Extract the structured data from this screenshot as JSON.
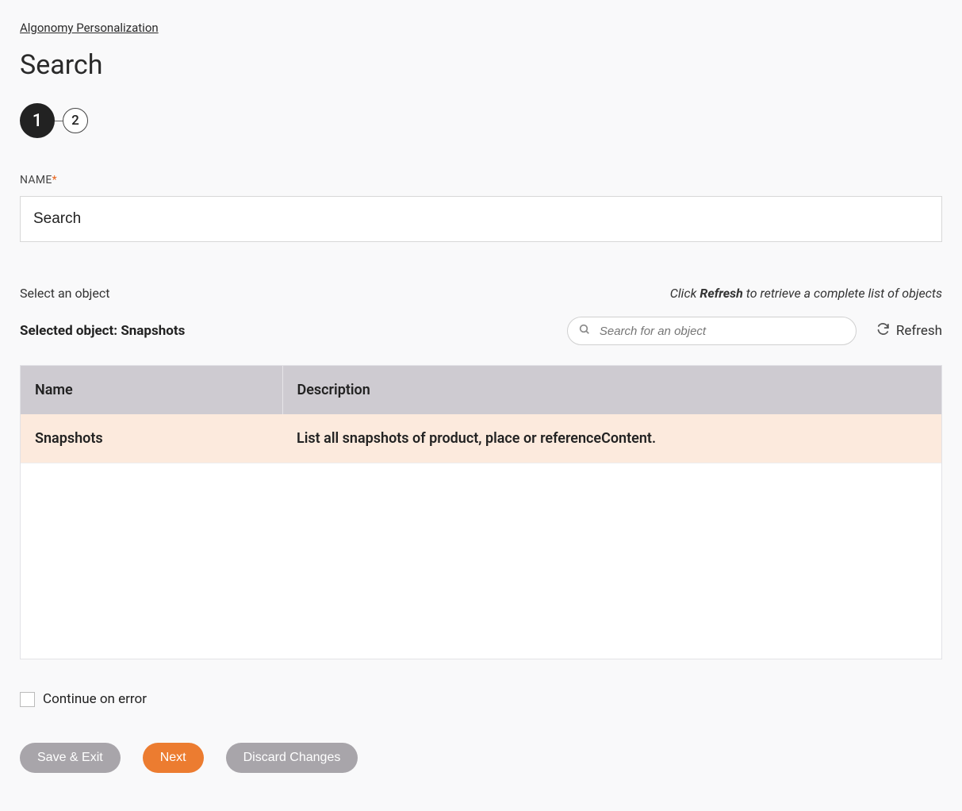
{
  "breadcrumb": "Algonomy Personalization",
  "page_title": "Search",
  "steps": {
    "s1": "1",
    "s2": "2"
  },
  "name_field": {
    "label": "NAME",
    "required": "*",
    "value": "Search"
  },
  "object_section": {
    "select_label": "Select an object",
    "hint_prefix": "Click ",
    "hint_bold": "Refresh",
    "hint_suffix": " to retrieve a complete list of objects",
    "selected_prefix": "Selected object: ",
    "selected_value": "Snapshots",
    "search_placeholder": "Search for an object",
    "refresh_label": "Refresh"
  },
  "table": {
    "headers": {
      "name": "Name",
      "description": "Description"
    },
    "rows": [
      {
        "name": "Snapshots",
        "description": "List all snapshots of product, place or referenceContent."
      }
    ]
  },
  "continue_on_error": "Continue on error",
  "footer": {
    "save_exit": "Save & Exit",
    "next": "Next",
    "discard": "Discard Changes"
  }
}
